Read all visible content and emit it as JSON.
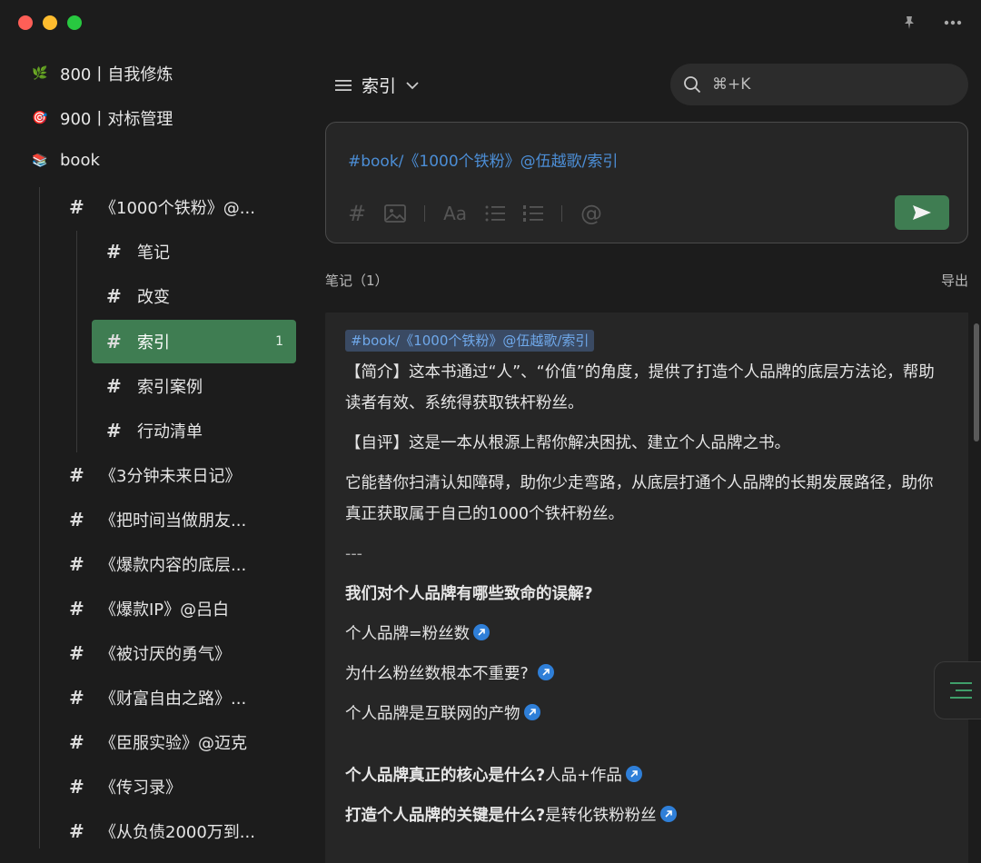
{
  "sidebar": {
    "top_items": [
      {
        "emoji": "🌿",
        "label": "800丨自我修炼"
      },
      {
        "emoji": "🎯",
        "label": "900丨对标管理"
      },
      {
        "emoji": "📚",
        "label": "book"
      }
    ],
    "book_children": [
      {
        "label": "《1000个铁粉》@..."
      },
      {
        "label": "《3分钟未来日记》"
      },
      {
        "label": "《把时间当做朋友..."
      },
      {
        "label": "《爆款内容的底层..."
      },
      {
        "label": "《爆款IP》@吕白"
      },
      {
        "label": "《被讨厌的勇气》"
      },
      {
        "label": "《财富自由之路》..."
      },
      {
        "label": "《臣服实验》@迈克"
      },
      {
        "label": "《传习录》"
      },
      {
        "label": "《从负债2000万到..."
      }
    ],
    "sub_children": [
      {
        "label": "笔记"
      },
      {
        "label": "改变"
      },
      {
        "label": "索引",
        "count": "1"
      },
      {
        "label": "索引案例"
      },
      {
        "label": "行动清单"
      }
    ],
    "hash": "#"
  },
  "header": {
    "title": "索引",
    "search_shortcut": "⌘+K"
  },
  "editor": {
    "text": "#book/《1000个铁粉》@伍越歌/索引"
  },
  "notes_bar": {
    "label": "笔记（1）",
    "export": "导出"
  },
  "note": {
    "tag": "#book/《1000个铁粉》@伍越歌/索引",
    "intro": "【简介】这本书通过“人”、“价值”的角度，提供了打造个人品牌的底层方法论，帮助读者有效、系统得获取铁杆粉丝。",
    "review": "【自评】这是一本从根源上帮你解决困扰、建立个人品牌之书。",
    "body": "它能替你扫清认知障碍，助你少走弯路，从底层打通个人品牌的长期发展路径，助你真正获取属于自己的1000个铁杆粉丝。",
    "divider": "---",
    "q1": "我们对个人品牌有哪些致命的误解?",
    "l1": "个人品牌=粉丝数",
    "l2": "为什么粉丝数根本不重要?",
    "l3": "个人品牌是互联网的产物",
    "q2": "个人品牌真正的核心是什么?",
    "a2": "人品+作品",
    "q3": "打造个人品牌的关键是什么?",
    "a3": "是转化铁粉粉丝"
  },
  "colors": {
    "accent_green": "#3f7d52",
    "tag_blue": "#4c8ed6",
    "link_blue": "#2f7fd8"
  }
}
